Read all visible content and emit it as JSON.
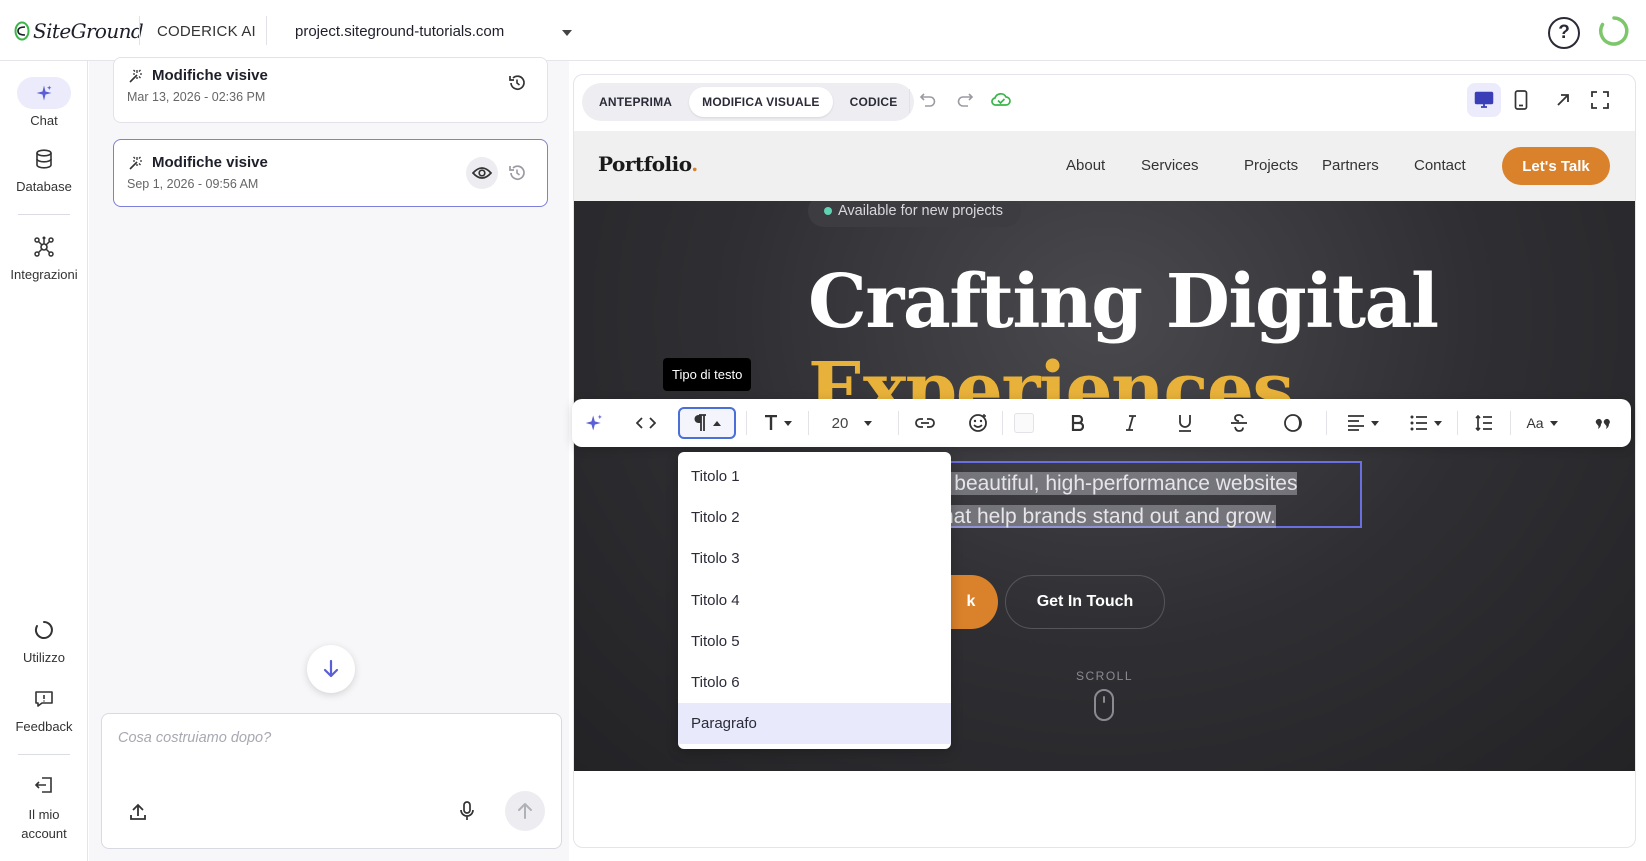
{
  "topbar": {
    "logo_text": "SiteGround",
    "product": "CODERICK AI",
    "domain": "project.siteground-tutorials.com",
    "help": "?"
  },
  "leftnav": {
    "items": [
      {
        "label": "Chat",
        "icon": "sparkle-icon"
      },
      {
        "label": "Database",
        "icon": "database-icon"
      },
      {
        "label": "Integrazioni",
        "icon": "integrations-icon"
      },
      {
        "label": "Utilizzo",
        "icon": "usage-icon"
      },
      {
        "label": "Feedback",
        "icon": "feedback-icon"
      },
      {
        "label": "Il mio account",
        "icon": "logout-icon"
      }
    ]
  },
  "chat": {
    "history": [
      {
        "title": "Modifiche visive",
        "date": "Mar 13, 2026 - 02:36 PM"
      },
      {
        "title": "Modifiche visive",
        "date": "Sep 1, 2026 - 09:56 AM"
      }
    ],
    "input_placeholder": "Cosa costruiamo dopo?"
  },
  "editor": {
    "tabs": [
      "ANTEPRIMA",
      "MODIFICA VISUALE",
      "CODICE"
    ],
    "active_tab": "MODIFICA VISUALE"
  },
  "site": {
    "brand": "Portfolio",
    "brand_dot": ".",
    "nav": [
      "About",
      "Services",
      "Projects",
      "Partners",
      "Contact"
    ],
    "cta": "Let's Talk",
    "badge": "Available for new projects",
    "title_line1": "Crafting Digital",
    "title_line2": "Experiences",
    "desc_line1": "evelop beautiful, high-performance websites",
    "desc_line2": "ns that help brands stand out and grow.",
    "btn_primary": "k",
    "btn_outline": "Get In Touch",
    "scroll": "SCROLL"
  },
  "toolbar": {
    "tooltip": "Tipo di testo",
    "font_size": "20",
    "case_label": "Aa"
  },
  "dropdown": {
    "options": [
      "Titolo 1",
      "Titolo 2",
      "Titolo 3",
      "Titolo 4",
      "Titolo 5",
      "Titolo 6",
      "Paragrafo"
    ],
    "selected": "Paragrafo"
  },
  "colors": {
    "accent": "#5b5fd6",
    "orange": "#d9822b",
    "green": "#39b54a"
  }
}
